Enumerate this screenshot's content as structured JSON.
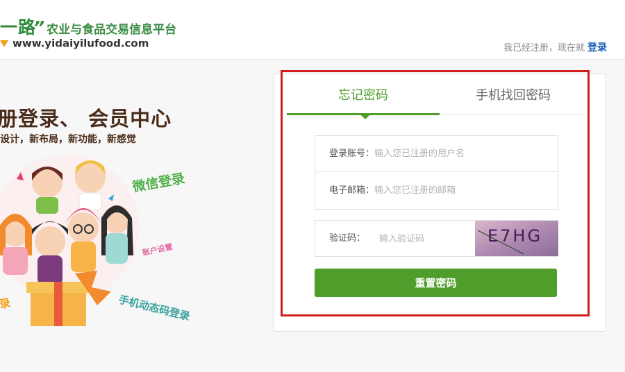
{
  "header": {
    "brand_name": "一路",
    "brand_quote": "”",
    "brand_tagline": "农业与食品交易信息平台",
    "brand_url": "www.yidaiyilufood.com",
    "login_prompt": "我已经注册，现在就",
    "login_link": "登录"
  },
  "promo": {
    "title": "册登录、 会员中心",
    "subtitle": "设计，新布局，新功能，新感觉",
    "tags": {
      "wechat": "微信登录",
      "account": "账户设置",
      "sms": "手机动态码登录",
      "left": "录"
    }
  },
  "tabs": [
    {
      "label": "忘记密码",
      "active": true
    },
    {
      "label": "手机找回密码",
      "active": false
    }
  ],
  "form": {
    "account": {
      "label": "登录账号：",
      "placeholder": "输入您已注册的用户名"
    },
    "email": {
      "label": "电子邮箱：",
      "placeholder": "输入您已注册的邮箱"
    },
    "captcha": {
      "label": "验证码：",
      "placeholder": "输入验证码",
      "image_text": "E7HG"
    },
    "submit_label": "重置密码"
  },
  "colors": {
    "brand_green": "#4f9d2a",
    "highlight_red": "#d21d1d",
    "link_blue": "#1a5fb4"
  }
}
